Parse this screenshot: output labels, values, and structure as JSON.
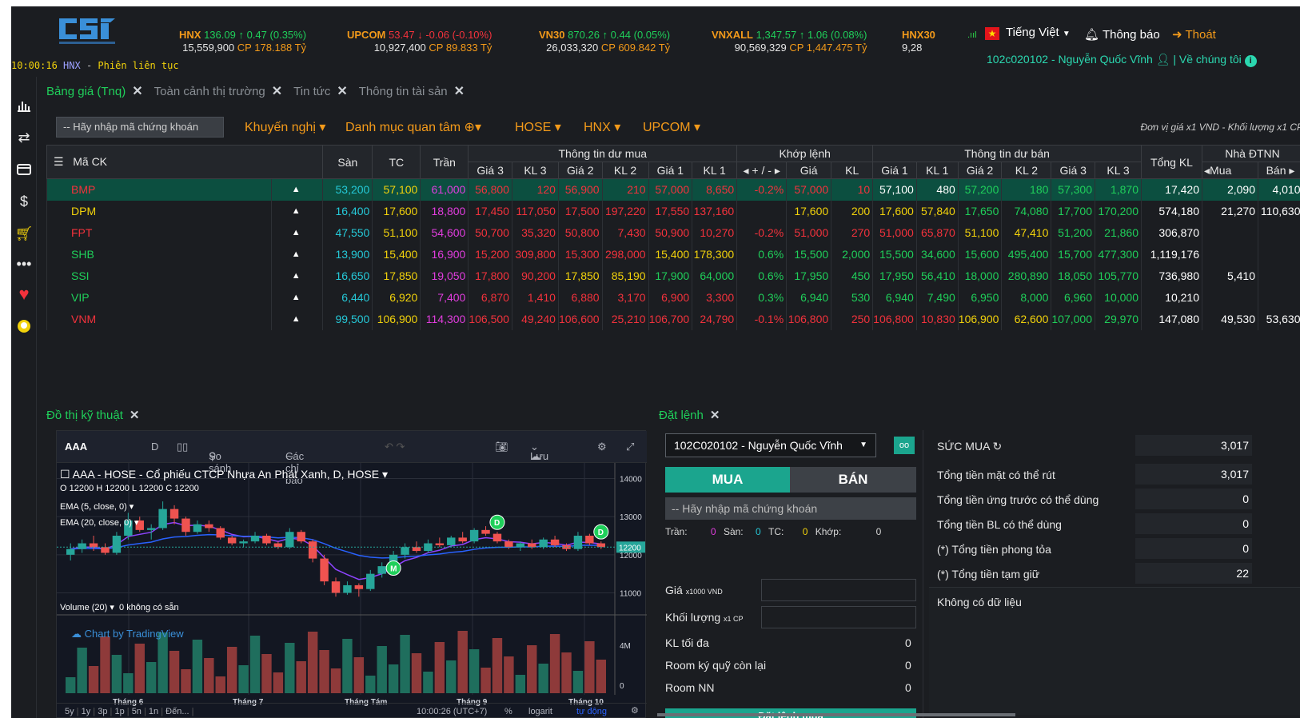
{
  "header": {
    "clock": "10:00:16",
    "clock_exchange": "HNX",
    "clock_sep": "-",
    "session": "Phiên liên tục",
    "indices": [
      {
        "name": "HNX",
        "value": "136.09",
        "arrow": "↑",
        "change": "0.47",
        "pct": "(0.35%)",
        "vol": "15,559,900",
        "cp": "CP",
        "val": "178.188 Tỷ",
        "dir": "up"
      },
      {
        "name": "UPCOM",
        "value": "53.47",
        "arrow": "↓",
        "change": "-0.06",
        "pct": "(-0.10%)",
        "vol": "10,927,400",
        "cp": "CP",
        "val": "89.833 Tỷ",
        "dir": "down"
      },
      {
        "name": "VN30",
        "value": "870.26",
        "arrow": "↑",
        "change": "0.44",
        "pct": "(0.05%)",
        "vol": "26,033,320",
        "cp": "CP",
        "val": "609.842 Tỷ",
        "dir": "up"
      },
      {
        "name": "VNXALL",
        "value": "1,347.57",
        "arrow": "↑",
        "change": "1.06",
        "pct": "(0.08%)",
        "vol": "90,569,329",
        "cp": "CP",
        "val": "1,447.475 Tỷ",
        "dir": "up"
      },
      {
        "name": "HNX30",
        "vol": "9,28"
      }
    ],
    "language": "Tiếng Việt",
    "notifications": "Thông báo",
    "logout": "Thoát",
    "user": "102c020102 - Nguyễn Quốc Vĩnh",
    "about": "| Về chúng tôi"
  },
  "tabs": [
    "Bảng giá (Tnq)",
    "Toàn cảnh thị trường",
    "Tin tức",
    "Thông tin tài sản"
  ],
  "toolbar": {
    "search_placeholder": "-- Hãy nhập mã chứng khoán",
    "menus": [
      "Khuyến nghị ▾",
      "Danh mục quan tâm",
      "HOSE ▾",
      "HNX ▾",
      "UPCOM ▾"
    ],
    "unit_note": "Đơn vị giá x1 VND - Khối lượng x1 CP"
  },
  "table": {
    "headers_top": {
      "symbol": "Mã CK",
      "floor": "Sàn",
      "ref": "TC",
      "ceil": "Trần",
      "buy": "Thông tin dư mua",
      "match": "Khớp lệnh",
      "sell": "Thông tin dư bán",
      "total": "Tổng KL",
      "foreign": "Nhà ĐTNN"
    },
    "headers_sub": [
      "Giá 3",
      "KL 3",
      "Giá 2",
      "KL 2",
      "Giá 1",
      "KL 1",
      "◂ + / - ▸",
      "Giá",
      "KL",
      "Giá 1",
      "KL 1",
      "Giá 2",
      "KL 2",
      "Giá 3",
      "KL 3",
      "◂Mua",
      "Bán ▸"
    ],
    "rows": [
      {
        "sym": "BMP",
        "cells": [
          "53,200",
          "57,100",
          "61,000",
          "56,800",
          "120",
          "56,900",
          "210",
          "57,000",
          "8,650",
          "-0.2%",
          "57,000",
          "10",
          "57,100",
          "480",
          "57,200",
          "180",
          "57,300",
          "1,870",
          "17,420",
          "2,090",
          "4,010"
        ],
        "cls": [
          "c",
          "y",
          "m",
          "r",
          "r",
          "r",
          "r",
          "r",
          "r",
          "r",
          "r",
          "r",
          "w",
          "w",
          "g",
          "g",
          "g",
          "g",
          "w",
          "w",
          "w"
        ],
        "hl": true
      },
      {
        "sym": "DPM",
        "cells": [
          "16,400",
          "17,600",
          "18,800",
          "17,450",
          "117,050",
          "17,500",
          "197,220",
          "17,550",
          "137,160",
          "",
          "17,600",
          "200",
          "17,600",
          "57,840",
          "17,650",
          "74,080",
          "17,700",
          "170,200",
          "574,180",
          "21,270",
          "110,630"
        ],
        "cls": [
          "c",
          "y",
          "m",
          "r",
          "r",
          "r",
          "r",
          "r",
          "r",
          "w",
          "y",
          "y",
          "y",
          "y",
          "g",
          "g",
          "g",
          "g",
          "w",
          "w",
          "w"
        ]
      },
      {
        "sym": "FPT",
        "cells": [
          "47,550",
          "51,100",
          "54,600",
          "50,700",
          "35,320",
          "50,800",
          "7,430",
          "50,900",
          "10,270",
          "-0.2%",
          "51,000",
          "270",
          "51,000",
          "65,870",
          "51,100",
          "47,410",
          "51,200",
          "21,860",
          "306,870",
          "",
          ""
        ],
        "cls": [
          "c",
          "y",
          "m",
          "r",
          "r",
          "r",
          "r",
          "r",
          "r",
          "r",
          "r",
          "r",
          "r",
          "r",
          "y",
          "y",
          "g",
          "g",
          "w",
          "w",
          "w"
        ]
      },
      {
        "sym": "SHB",
        "cells": [
          "13,900",
          "15,400",
          "16,900",
          "15,200",
          "309,800",
          "15,300",
          "298,000",
          "15,400",
          "178,300",
          "0.6%",
          "15,500",
          "2,000",
          "15,500",
          "34,600",
          "15,600",
          "495,400",
          "15,700",
          "477,300",
          "1,119,176",
          "",
          ""
        ],
        "cls": [
          "c",
          "y",
          "m",
          "r",
          "r",
          "r",
          "r",
          "y",
          "y",
          "g",
          "g",
          "g",
          "g",
          "g",
          "g",
          "g",
          "g",
          "g",
          "w",
          "w",
          "w"
        ]
      },
      {
        "sym": "SSI",
        "cells": [
          "16,650",
          "17,850",
          "19,050",
          "17,800",
          "90,200",
          "17,850",
          "85,190",
          "17,900",
          "64,000",
          "0.6%",
          "17,950",
          "450",
          "17,950",
          "56,410",
          "18,000",
          "280,890",
          "18,050",
          "105,770",
          "736,980",
          "5,410",
          ""
        ],
        "cls": [
          "c",
          "y",
          "m",
          "r",
          "r",
          "y",
          "y",
          "g",
          "g",
          "g",
          "g",
          "g",
          "g",
          "g",
          "g",
          "g",
          "g",
          "g",
          "w",
          "w",
          "w"
        ]
      },
      {
        "sym": "VIP",
        "cells": [
          "6,440",
          "6,920",
          "7,400",
          "6,870",
          "1,410",
          "6,880",
          "3,170",
          "6,900",
          "3,300",
          "0.3%",
          "6,940",
          "530",
          "6,940",
          "7,490",
          "6,950",
          "8,000",
          "6,960",
          "10,000",
          "10,210",
          "",
          ""
        ],
        "cls": [
          "c",
          "y",
          "m",
          "r",
          "r",
          "r",
          "r",
          "r",
          "r",
          "g",
          "g",
          "g",
          "g",
          "g",
          "g",
          "g",
          "g",
          "g",
          "w",
          "w",
          "w"
        ]
      },
      {
        "sym": "VNM",
        "cells": [
          "99,500",
          "106,900",
          "114,300",
          "106,500",
          "49,240",
          "106,600",
          "25,210",
          "106,700",
          "24,790",
          "-0.1%",
          "106,800",
          "250",
          "106,800",
          "10,830",
          "106,900",
          "62,600",
          "107,000",
          "29,970",
          "147,080",
          "49,530",
          "53,630"
        ],
        "cls": [
          "c",
          "y",
          "m",
          "r",
          "r",
          "r",
          "r",
          "r",
          "r",
          "r",
          "r",
          "r",
          "r",
          "r",
          "y",
          "y",
          "g",
          "g",
          "w",
          "w",
          "w"
        ]
      }
    ],
    "row_arrow": "▲"
  },
  "chart_panel": {
    "title": "Đồ thị kỹ thuật",
    "symbol": "AAA",
    "interval": "D",
    "compare": "So sánh",
    "indicators": "Các chỉ báo",
    "save": "Lưu",
    "legend": "AAA - HOSE - Cổ phiếu CTCP Nhựa An Phát Xanh, D, HOSE ▾",
    "ohlc": "O 12200  H 12200  L 12200  C 12200",
    "ema5": "EMA (5, close, 0) ▾",
    "ema20": "EMA (20, close, 0) ▾",
    "volume": "Volume (20) ▾",
    "vol_na": "0  không có sẵn",
    "credit": "Chart by TradingView",
    "price_last": "12200",
    "ranges": [
      "5y",
      "1y",
      "3p",
      "1p",
      "5n",
      "1n",
      "Đến..."
    ],
    "time": "10:00:26 (UTC+7)",
    "pct": "%",
    "log": "logarit",
    "auto": "tự động"
  },
  "chart_data": {
    "type": "candlestick",
    "symbol": "AAA",
    "ylim": [
      10800,
      14200
    ],
    "yticks": [
      14000,
      13000,
      12000,
      11000
    ],
    "vol_ticks": [
      "4M",
      "0"
    ],
    "x_labels": [
      "Tháng 6",
      "Tháng 7",
      "Tháng Tám",
      "Tháng 9",
      "Tháng 10"
    ],
    "candles": [
      [
        12000,
        12300,
        11850,
        12150
      ],
      [
        12150,
        12400,
        12050,
        12300
      ],
      [
        12300,
        12500,
        12100,
        12200
      ],
      [
        12200,
        12300,
        12000,
        12050
      ],
      [
        12050,
        12600,
        12000,
        12500
      ],
      [
        12500,
        13100,
        12400,
        12900
      ],
      [
        12900,
        13000,
        12600,
        12650
      ],
      [
        12650,
        12800,
        12400,
        12700
      ],
      [
        12700,
        13400,
        12650,
        13200
      ],
      [
        13200,
        13300,
        12800,
        12950
      ],
      [
        12950,
        13000,
        12500,
        12600
      ],
      [
        12600,
        12900,
        12550,
        12800
      ],
      [
        12800,
        12900,
        12600,
        12700
      ],
      [
        12700,
        12750,
        12400,
        12450
      ],
      [
        12450,
        12500,
        12250,
        12300
      ],
      [
        12300,
        12400,
        12200,
        12350
      ],
      [
        12350,
        12600,
        12300,
        12500
      ],
      [
        12500,
        12550,
        12250,
        12300
      ],
      [
        12300,
        12350,
        12150,
        12200
      ],
      [
        12200,
        12700,
        12150,
        12600
      ],
      [
        12600,
        12650,
        12300,
        12350
      ],
      [
        12350,
        12400,
        11800,
        11900
      ],
      [
        11900,
        12000,
        11200,
        11300
      ],
      [
        11300,
        11400,
        10900,
        11000
      ],
      [
        11000,
        11300,
        10950,
        11200
      ],
      [
        11200,
        11250,
        10900,
        11100
      ],
      [
        11100,
        11600,
        11050,
        11500
      ],
      [
        11500,
        11800,
        11400,
        11700
      ],
      [
        11700,
        12100,
        11650,
        12000
      ],
      [
        12000,
        12300,
        11900,
        12200
      ],
      [
        12200,
        12350,
        12050,
        12100
      ],
      [
        12100,
        12400,
        12050,
        12300
      ],
      [
        12300,
        12450,
        12200,
        12250
      ],
      [
        12250,
        12500,
        12200,
        12450
      ],
      [
        12450,
        12600,
        12300,
        12350
      ],
      [
        12350,
        12700,
        12300,
        12650
      ],
      [
        12650,
        12750,
        12500,
        12550
      ],
      [
        12550,
        12600,
        12300,
        12350
      ],
      [
        12350,
        12400,
        12150,
        12200
      ],
      [
        12200,
        12350,
        12100,
        12300
      ],
      [
        12300,
        12400,
        12150,
        12200
      ],
      [
        12200,
        12450,
        12150,
        12400
      ],
      [
        12400,
        12500,
        12200,
        12250
      ],
      [
        12250,
        12300,
        12100,
        12150
      ],
      [
        12150,
        12600,
        12100,
        12500
      ],
      [
        12500,
        12550,
        12250,
        12300
      ],
      [
        12300,
        12350,
        12150,
        12200
      ]
    ],
    "signals": [
      {
        "label": "M",
        "i": 28
      },
      {
        "label": "D",
        "i": 37
      },
      {
        "label": "D",
        "i": 46
      }
    ]
  },
  "order_panel": {
    "title": "Đặt lệnh",
    "account": "102C020102 - Nguyễn Quốc Vĩnh",
    "oo": "oo",
    "buy": "MUA",
    "sell": "BÁN",
    "search": "-- Hãy nhập mã chứng khoán",
    "ceil_lbl": "Trần:",
    "ceil": "0",
    "floor_lbl": "Sàn:",
    "floor": "0",
    "ref_lbl": "TC:",
    "ref": "0",
    "match_lbl": "Khớp:",
    "match": "0",
    "price_lbl": "Giá",
    "price_unit": "x1000 VND",
    "qty_lbl": "Khối lượng",
    "qty_unit": "x1 CP",
    "max_lbl": "KL tối đa",
    "max": "0",
    "room_lbl": "Room ký quỹ còn lại",
    "room": "0",
    "nn_lbl": "Room NN",
    "nn": "0",
    "place": "Đặt lệnh mua",
    "power": "SỨC MUA",
    "money": [
      [
        "Tổng tiền mặt có thể rút",
        "3,017"
      ],
      [
        "Tổng tiền ứng trước có thể dùng",
        "0"
      ],
      [
        "Tổng tiền BL có thể dùng",
        "0"
      ],
      [
        "(*) Tổng tiền phong tỏa",
        "0"
      ],
      [
        "(*) Tổng tiền tạm giữ",
        "22"
      ]
    ],
    "power_val": "3,017",
    "nodata": "Không có dữ liệu"
  }
}
